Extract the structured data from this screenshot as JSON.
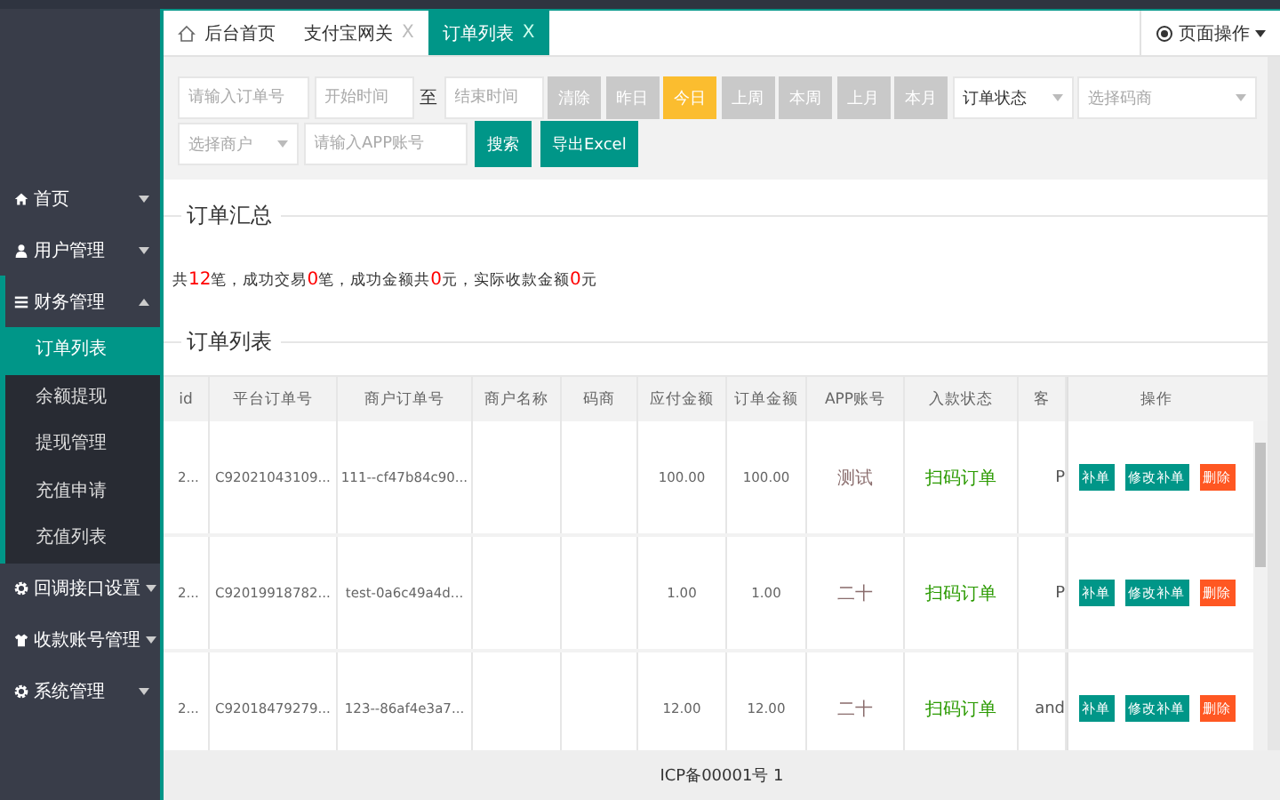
{
  "sidebar": {
    "items": [
      {
        "label": "首页",
        "kind": "home",
        "expanded": false
      },
      {
        "label": "用户管理",
        "kind": "user",
        "expanded": false
      },
      {
        "label": "财务管理",
        "kind": "list",
        "expanded": true,
        "children": [
          {
            "label": "订单列表",
            "selected": true
          },
          {
            "label": "余额提现",
            "selected": false
          },
          {
            "label": "提现管理",
            "selected": false
          },
          {
            "label": "充值申请",
            "selected": false
          },
          {
            "label": "充值列表",
            "selected": false
          }
        ]
      },
      {
        "label": "回调接口设置",
        "kind": "gear",
        "expanded": false
      },
      {
        "label": "收款账号管理",
        "kind": "shirt",
        "expanded": false
      },
      {
        "label": "系统管理",
        "kind": "gear",
        "expanded": false
      }
    ]
  },
  "tabs": [
    {
      "label": "后台首页",
      "kind": "home",
      "selected": false
    },
    {
      "label": "支付宝网关",
      "kind": "closable",
      "close": "X",
      "selected": false
    },
    {
      "label": "订单列表",
      "kind": "closable",
      "close": "X",
      "selected": true
    }
  ],
  "page_actions": "页面操作",
  "filters": [
    [
      {
        "kind": "input",
        "placeholder": "请输入订单号"
      },
      {
        "kind": "input",
        "placeholder": "开始时间"
      },
      {
        "kind": "text",
        "label": "至"
      },
      {
        "kind": "input",
        "placeholder": "结束时间"
      },
      {
        "kind": "date_button",
        "label": "清除",
        "selected": false
      },
      {
        "kind": "date_button",
        "label": "昨日",
        "selected": false
      },
      {
        "kind": "date_button",
        "label": "今日",
        "selected": true
      },
      {
        "kind": "date_button",
        "label": "上周",
        "selected": false
      },
      {
        "kind": "date_button",
        "label": "本周",
        "selected": false
      },
      {
        "kind": "date_button",
        "label": "上月",
        "selected": false
      },
      {
        "kind": "date_button",
        "label": "本月",
        "selected": false
      },
      {
        "kind": "select",
        "value": "订单状态"
      },
      {
        "kind": "select",
        "placeholder": "选择码商"
      }
    ],
    [
      {
        "kind": "select",
        "placeholder": "选择商户"
      },
      {
        "kind": "input",
        "placeholder": "请输入APP账号"
      },
      {
        "kind": "action",
        "label": "搜索"
      },
      {
        "kind": "action",
        "label": "导出Excel"
      }
    ]
  ],
  "summary": {
    "title": "订单汇总",
    "parts": [
      {
        "text": "共",
        "highlight": false
      },
      {
        "text": "12",
        "highlight": true
      },
      {
        "text": "笔，成功交易",
        "highlight": false
      },
      {
        "text": "0",
        "highlight": true
      },
      {
        "text": "笔，成功金额共",
        "highlight": false
      },
      {
        "text": "0",
        "highlight": true
      },
      {
        "text": "元，实际收款金额",
        "highlight": false
      },
      {
        "text": "0",
        "highlight": true
      },
      {
        "text": "元",
        "highlight": false
      }
    ]
  },
  "table": {
    "title": "订单列表",
    "columns": [
      "id",
      "平台订单号",
      "商户订单号",
      "商户名称",
      "码商",
      "应付金额",
      "订单金额",
      "APP账号",
      "入款状态",
      "客",
      "操作"
    ],
    "rows": [
      {
        "cells": [
          "2...",
          "C92021043109...",
          "111--cf47b84c90...",
          "",
          "",
          "100.00",
          "100.00"
        ],
        "account": "测试",
        "status": "扫码订单",
        "customer": "P",
        "actions": [
          {
            "label": "补单",
            "kind": "primary"
          },
          {
            "label": "修改补单",
            "kind": "primary"
          },
          {
            "label": "删除",
            "kind": "danger"
          }
        ]
      },
      {
        "cells": [
          "2...",
          "C92019918782...",
          "test-0a6c49a4d...",
          "",
          "",
          "1.00",
          "1.00"
        ],
        "account": "二十",
        "status": "扫码订单",
        "customer": "P",
        "actions": [
          {
            "label": "补单",
            "kind": "primary"
          },
          {
            "label": "修改补单",
            "kind": "primary"
          },
          {
            "label": "删除",
            "kind": "danger"
          }
        ]
      },
      {
        "cells": [
          "2...",
          "C92018479279...",
          "123--86af4e3a7...",
          "",
          "",
          "12.00",
          "12.00"
        ],
        "account": "二十",
        "status": "扫码订单",
        "customer": "and",
        "actions": [
          {
            "label": "补单",
            "kind": "primary"
          },
          {
            "label": "修改补单",
            "kind": "primary"
          },
          {
            "label": "删除",
            "kind": "danger"
          }
        ]
      }
    ]
  },
  "footer": "ICP备00001号 1"
}
